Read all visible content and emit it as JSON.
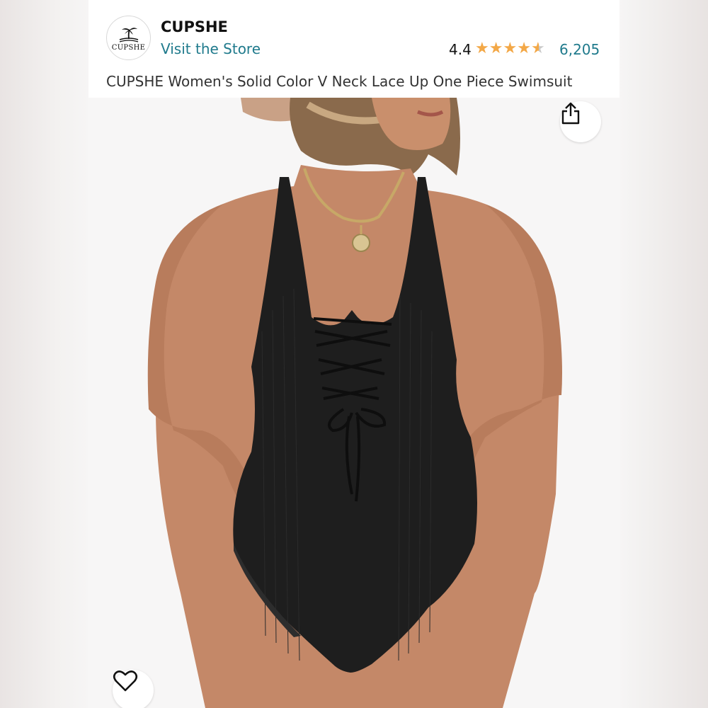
{
  "product": {
    "brand": "CUPSHE",
    "logo_text": "CUPSHE",
    "store_link": "Visit the Store",
    "rating": "4.4",
    "stars": [
      "full",
      "full",
      "full",
      "full",
      "half"
    ],
    "review_count": "6,205",
    "title": "CUPSHE Women's Solid Color V Neck Lace Up One Piece Swimsuit"
  },
  "icons": {
    "share": "share-icon",
    "favorite": "heart-icon",
    "logo": "palm-tree-icon"
  },
  "colors": {
    "link": "#1f7a8c",
    "star": "#f3a847",
    "swimsuit": "#1e1e1e"
  }
}
